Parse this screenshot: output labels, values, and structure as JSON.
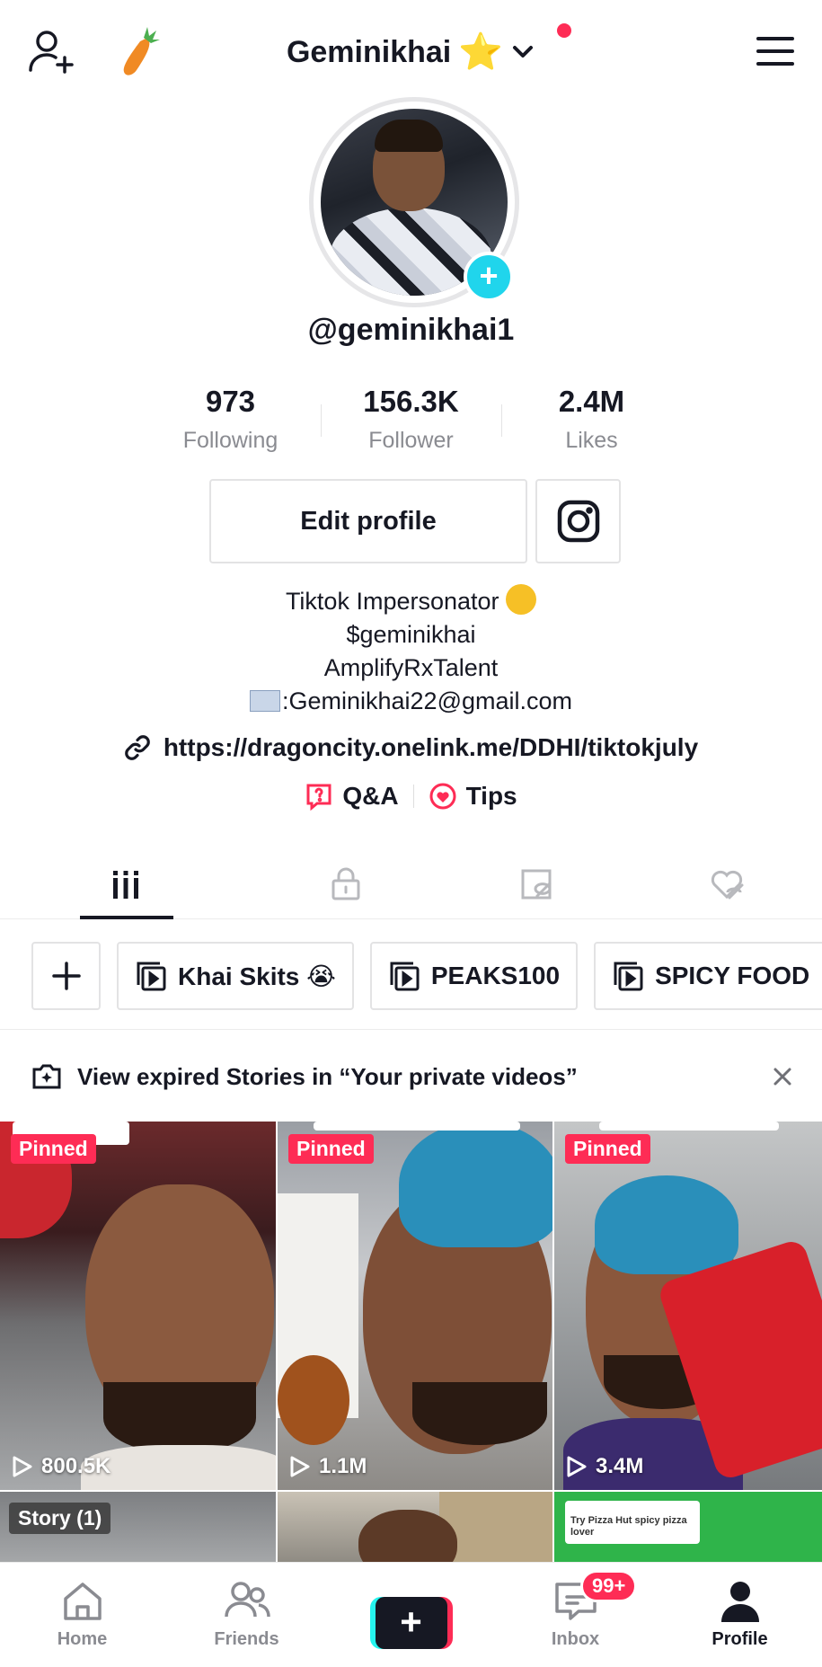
{
  "header": {
    "title": "Geminikhai",
    "title_emoji": "⭐"
  },
  "profile": {
    "username": "@geminikhai1",
    "stats": [
      {
        "value": "973",
        "label": "Following"
      },
      {
        "value": "156.3K",
        "label": "Follower"
      },
      {
        "value": "2.4M",
        "label": "Likes"
      }
    ],
    "edit_label": "Edit profile",
    "bio_lines": [
      "Tiktok Impersonator",
      "$geminikhai",
      "AmplifyRxTalent",
      ":Geminikhai22@gmail.com"
    ],
    "link": "https://dragoncity.onelink.me/DDHI/tiktokjuly",
    "qa_label": "Q&A",
    "tips_label": "Tips"
  },
  "playlists": [
    "Khai Skits 😭",
    "PEAKS100",
    "SPICY FOOD"
  ],
  "stories_banner": "View expired Stories in “Your private videos”",
  "videos": [
    {
      "badge": "Pinned",
      "views": "800.5K"
    },
    {
      "badge": "Pinned",
      "views": "1.1M"
    },
    {
      "badge": "Pinned",
      "views": "3.4M"
    }
  ],
  "story_badge": "Story (1)",
  "second_row_comment": "Try Pizza Hut spicy pizza lover",
  "nav": {
    "home": "Home",
    "friends": "Friends",
    "inbox": "Inbox",
    "inbox_badge": "99+",
    "profile": "Profile"
  },
  "colors": {
    "accent": "#fe2c55",
    "cyan": "#25f4ee",
    "text": "#161823",
    "muted": "#8a8b91"
  }
}
